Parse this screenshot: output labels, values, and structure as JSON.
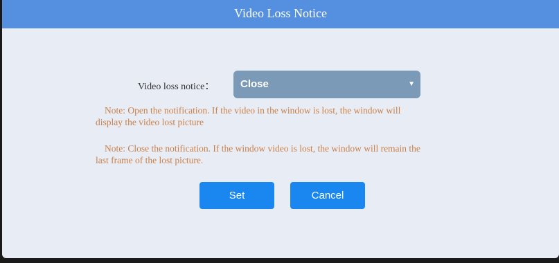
{
  "dialog": {
    "title": "Video Loss Notice"
  },
  "form": {
    "label": "Video loss notice：",
    "select_value": "Close",
    "select_arrow": "▼"
  },
  "notes": {
    "open_note": "Note: Open the notification. If the video in the window is lost, the window will display the video lost picture",
    "close_note": "Note: Close the notification. If the window video is lost, the window will remain the last frame of the lost picture."
  },
  "buttons": {
    "set_label": "Set",
    "cancel_label": "Cancel"
  },
  "colors": {
    "title_bar": "#5590e0",
    "background": "#e8edf5",
    "select": "#7a9ab8",
    "note_text": "#c9804a",
    "button": "#1a86f0"
  }
}
